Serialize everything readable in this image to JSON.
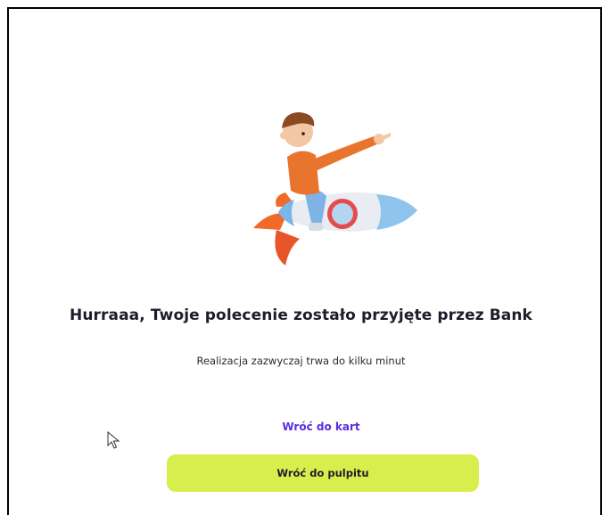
{
  "success_screen": {
    "title": "Hurraaa, Twoje polecenie zostało przyjęte przez Bank",
    "subtitle": "Realizacja zazwyczaj trwa do kilku minut",
    "back_to_cards_link": "Wróć do kart",
    "back_to_dashboard_button": "Wróć do pulpitu"
  },
  "colors": {
    "accent_button": "#d8ee4c",
    "link": "#5b2be0"
  },
  "icons": {
    "illustration": "boy-riding-rocket-illustration",
    "cursor": "mouse-pointer-icon"
  }
}
